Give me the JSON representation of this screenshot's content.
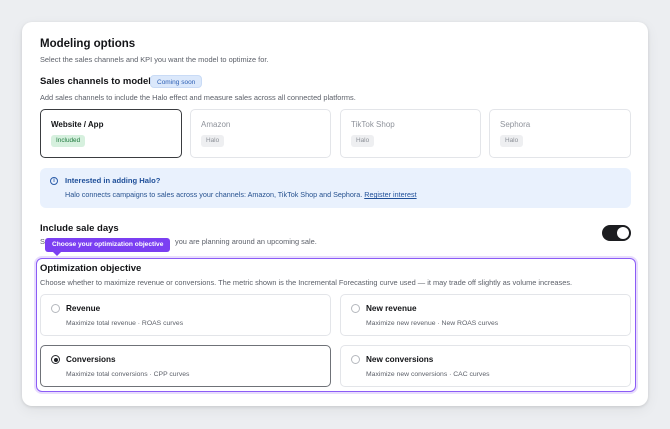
{
  "header": {
    "title": "Modeling options",
    "subtitle": "Select the sales channels and KPI you want the model to optimize for."
  },
  "sales_channels": {
    "title": "Sales channels to model",
    "badge": "Coming soon",
    "subtitle": "Add sales channels to include the Halo effect and measure sales across all connected platforms.",
    "items": [
      {
        "name": "Website / App",
        "tag": "Included"
      },
      {
        "name": "Amazon",
        "tag": "Halo"
      },
      {
        "name": "TikTok Shop",
        "tag": "Halo"
      },
      {
        "name": "Sephora",
        "tag": "Halo"
      }
    ]
  },
  "info_banner": {
    "icon": "info-icon",
    "title": "Interested in adding Halo?",
    "text": "Halo connects campaigns to sales across your channels: Amazon, TikTok Shop and Sephora.",
    "link": "Register interest"
  },
  "sale_days": {
    "title": "Include sale days",
    "subtitle_visible_start": "S",
    "subtitle_visible_end": "you are planning around an upcoming sale.",
    "toggle_on": true
  },
  "tooltip": {
    "text": "Choose your optimization objective"
  },
  "optimization": {
    "title": "Optimization objective",
    "subtitle": "Choose whether to maximize revenue or conversions. The metric shown is the Incremental Forecasting curve used — it may trade off slightly as volume increases.",
    "options": [
      {
        "title": "Revenue",
        "desc": "Maximize total revenue · ROAS curves",
        "selected": false
      },
      {
        "title": "New revenue",
        "desc": "Maximize new revenue · New ROAS curves",
        "selected": false
      },
      {
        "title": "Conversions",
        "desc": "Maximize total conversions · CPP curves",
        "selected": true
      },
      {
        "title": "New conversions",
        "desc": "Maximize new conversions · CAC curves",
        "selected": false
      }
    ]
  },
  "colors": {
    "accent_purple": "#8c5cf6",
    "tooltip_purple": "#7b3ff2",
    "info_bg": "#e9f1fd",
    "included_green": "#1f7a3e"
  }
}
